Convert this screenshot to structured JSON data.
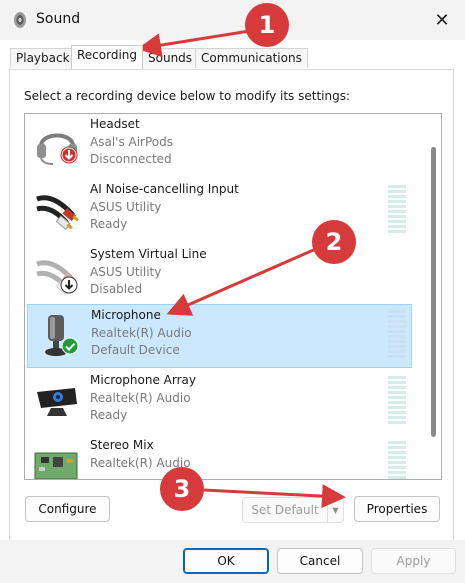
{
  "window": {
    "title": "Sound"
  },
  "tabs": [
    {
      "label": "Playback",
      "active": false
    },
    {
      "label": "Recording",
      "active": true
    },
    {
      "label": "Sounds",
      "active": false
    },
    {
      "label": "Communications",
      "active": false
    }
  ],
  "instruction": "Select a recording device below to modify its settings:",
  "devices": [
    {
      "name": "Headset",
      "sub": "Asal's AirPods",
      "status": "Disconnected",
      "icon": "headset-icon",
      "state_icon": "down-arrow-red-icon"
    },
    {
      "name": "AI Noise-cancelling Input",
      "sub": "ASUS Utility",
      "status": "Ready",
      "icon": "rca-cable-icon"
    },
    {
      "name": "System Virtual Line",
      "sub": "ASUS Utility",
      "status": "Disabled",
      "icon": "rca-cable-icon",
      "state_icon": "down-arrow-disabled-icon"
    },
    {
      "name": "Microphone",
      "sub": "Realtek(R) Audio",
      "status": "Default Device",
      "icon": "microphone-icon",
      "state_icon": "green-check-icon",
      "selected": true
    },
    {
      "name": "Microphone Array",
      "sub": "Realtek(R) Audio",
      "status": "Ready",
      "icon": "webcam-icon"
    },
    {
      "name": "Stereo Mix",
      "sub": "Realtek(R) Audio",
      "status": "",
      "icon": "circuit-board-icon"
    }
  ],
  "buttons": {
    "configure": "Configure",
    "set_default": "Set Default",
    "properties": "Properties",
    "ok": "OK",
    "cancel": "Cancel",
    "apply": "Apply"
  },
  "annotations": [
    "1",
    "2",
    "3"
  ],
  "colors": {
    "selection": "#cce8ff",
    "annotation": "#d63a3a",
    "accent": "#0067c0",
    "check": "#1e9e3a"
  }
}
